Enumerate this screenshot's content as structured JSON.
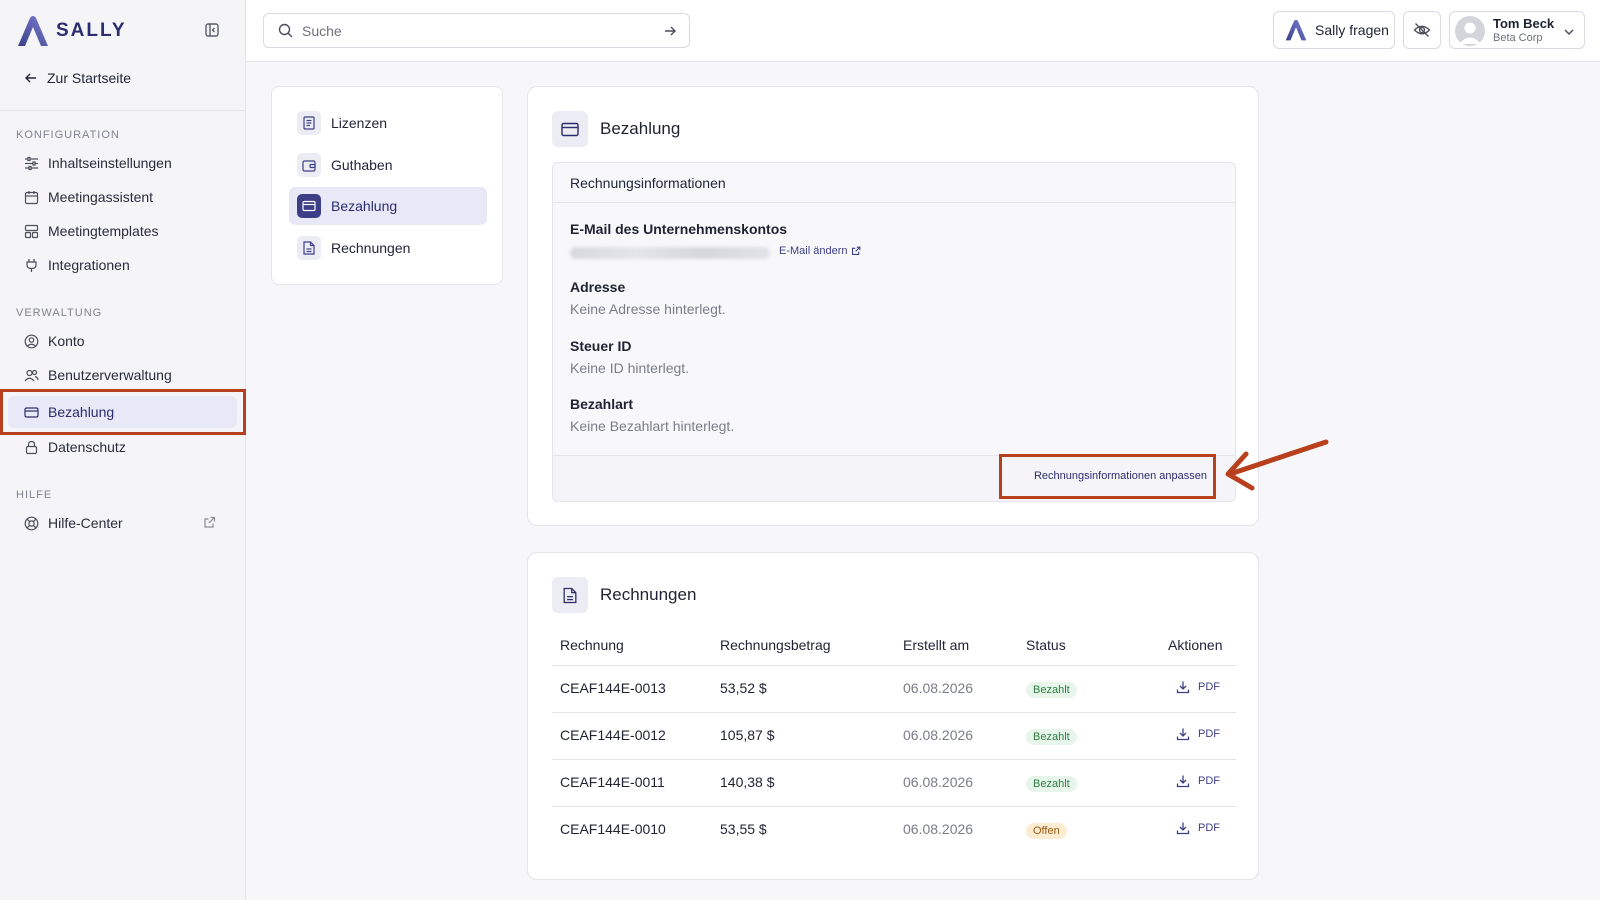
{
  "brand": {
    "name": "SALLY",
    "accent": "#3d3f86",
    "annotation_color": "#b8401c"
  },
  "sidebar": {
    "back_label": "Zur Startseite",
    "sections": [
      {
        "title": "KONFIGURATION",
        "items": [
          {
            "label": "Inhaltseinstellungen",
            "icon": "sliders-icon"
          },
          {
            "label": "Meetingassistent",
            "icon": "calendar-icon"
          },
          {
            "label": "Meetingtemplates",
            "icon": "template-icon"
          },
          {
            "label": "Integrationen",
            "icon": "plug-icon"
          }
        ]
      },
      {
        "title": "VERWALTUNG",
        "items": [
          {
            "label": "Konto",
            "icon": "user-circle-icon"
          },
          {
            "label": "Benutzerverwaltung",
            "icon": "users-icon"
          },
          {
            "label": "Bezahlung",
            "icon": "credit-card-icon",
            "active": true
          },
          {
            "label": "Datenschutz",
            "icon": "lock-icon"
          }
        ]
      },
      {
        "title": "HILFE",
        "items": [
          {
            "label": "Hilfe-Center",
            "icon": "lifebuoy-icon",
            "external": true
          }
        ]
      }
    ]
  },
  "header": {
    "search_placeholder": "Suche",
    "ask_sally_label": "Sally fragen",
    "user": {
      "name": "Tom Beck",
      "org": "Beta Corp"
    }
  },
  "settings_nav": {
    "items": [
      {
        "label": "Lizenzen",
        "icon": "license-icon"
      },
      {
        "label": "Guthaben",
        "icon": "wallet-icon"
      },
      {
        "label": "Bezahlung",
        "icon": "credit-card-icon",
        "active": true
      },
      {
        "label": "Rechnungen",
        "icon": "document-icon"
      }
    ]
  },
  "billing": {
    "title": "Bezahlung",
    "info_title": "Rechnungsinformationen",
    "email_label": "E-Mail des Unternehmenskontos",
    "email_change_label": "E-Mail ändern",
    "address_label": "Adresse",
    "address_value": "Keine Adresse hinterlegt.",
    "tax_label": "Steuer ID",
    "tax_value": "Keine ID hinterlegt.",
    "payment_label": "Bezahlart",
    "payment_value": "Keine Bezahlart hinterlegt.",
    "adjust_label": "Rechnungsinformationen anpassen"
  },
  "invoices": {
    "title": "Rechnungen",
    "columns": [
      "Rechnung",
      "Rechnungsbetrag",
      "Erstellt am",
      "Status",
      "Aktionen"
    ],
    "rows": [
      {
        "id": "CEAF144E-0013",
        "amount": "53,52 $",
        "date": "06.08.2026",
        "status": "Bezahlt",
        "action": "PDF"
      },
      {
        "id": "CEAF144E-0012",
        "amount": "105,87 $",
        "date": "06.08.2026",
        "status": "Bezahlt",
        "action": "PDF"
      },
      {
        "id": "CEAF144E-0011",
        "amount": "140,38 $",
        "date": "06.08.2026",
        "status": "Bezahlt",
        "action": "PDF"
      },
      {
        "id": "CEAF144E-0010",
        "amount": "53,55 $",
        "date": "06.08.2026",
        "status": "Offen",
        "action": "PDF"
      }
    ]
  }
}
